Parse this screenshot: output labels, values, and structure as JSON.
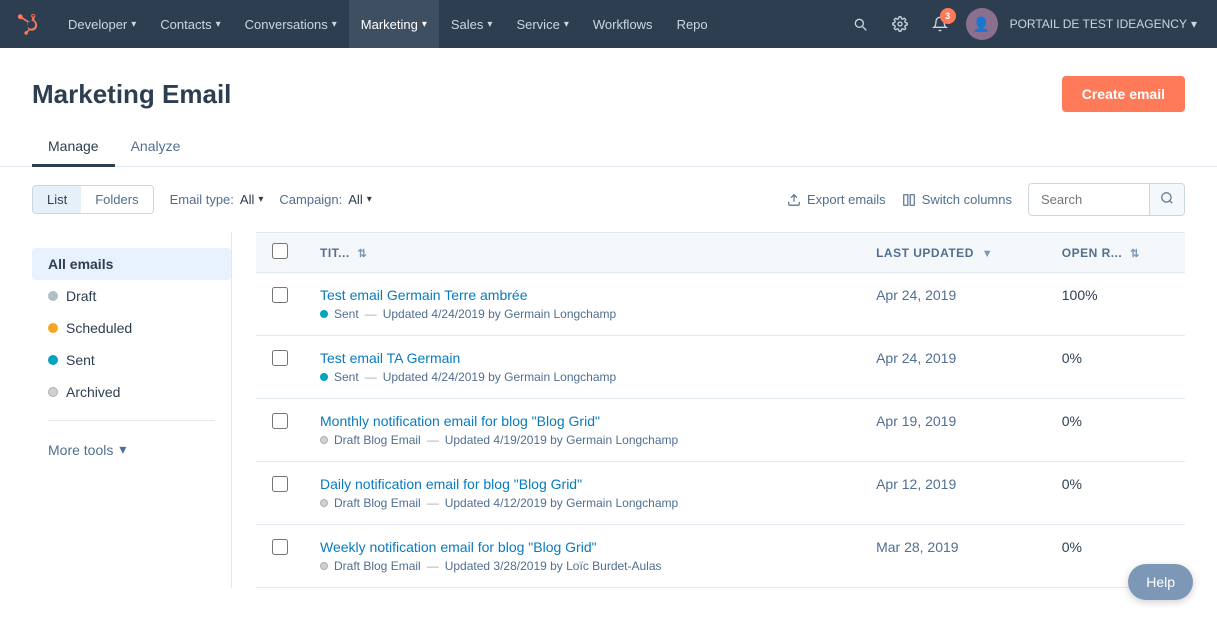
{
  "nav": {
    "logo_unicode": "⬡",
    "items": [
      {
        "label": "Developer",
        "has_chevron": true
      },
      {
        "label": "Contacts",
        "has_chevron": true
      },
      {
        "label": "Conversations",
        "has_chevron": true
      },
      {
        "label": "Marketing",
        "has_chevron": true,
        "active": true
      },
      {
        "label": "Sales",
        "has_chevron": true
      },
      {
        "label": "Service",
        "has_chevron": true
      },
      {
        "label": "Workflows",
        "has_chevron": false
      },
      {
        "label": "Repo",
        "has_chevron": false
      }
    ],
    "notification_count": "3",
    "portal_name": "PORTAIL DE TEST IDEAGENCY"
  },
  "page": {
    "title": "Marketing Email",
    "create_button": "Create email"
  },
  "tabs": [
    {
      "label": "Manage",
      "active": true
    },
    {
      "label": "Analyze",
      "active": false
    }
  ],
  "filters": {
    "list_label": "List",
    "folders_label": "Folders",
    "email_type_label": "Email type:",
    "email_type_value": "All",
    "campaign_label": "Campaign:",
    "campaign_value": "All",
    "export_label": "Export emails",
    "switch_columns_label": "Switch columns",
    "search_placeholder": "Search"
  },
  "sidebar": {
    "all_emails_label": "All emails",
    "items": [
      {
        "label": "Draft",
        "dot_class": "dot-grey"
      },
      {
        "label": "Scheduled",
        "dot_class": "dot-yellow"
      },
      {
        "label": "Sent",
        "dot_class": "dot-green"
      },
      {
        "label": "Archived",
        "dot_class": "dot-light-grey"
      }
    ],
    "more_tools_label": "More tools"
  },
  "table": {
    "headers": [
      {
        "label": "TIT...",
        "sortable": true
      },
      {
        "label": "LAST UPDATED",
        "sortable": true
      },
      {
        "label": "OPEN R...",
        "sortable": true
      }
    ],
    "rows": [
      {
        "name": "Test email Germain Terre ambrée",
        "status": "Sent",
        "status_class": "status-sent",
        "meta": "Updated 4/24/2019 by Germain Longchamp",
        "date": "Apr 24, 2019",
        "rate": "100%"
      },
      {
        "name": "Test email TA Germain",
        "status": "Sent",
        "status_class": "status-sent",
        "meta": "Updated 4/24/2019 by Germain Longchamp",
        "date": "Apr 24, 2019",
        "rate": "0%"
      },
      {
        "name": "Monthly notification email for blog \"Blog Grid\"",
        "status": "Draft Blog Email",
        "status_class": "status-draft",
        "meta": "Updated 4/19/2019 by Germain Longchamp",
        "date": "Apr 19, 2019",
        "rate": "0%"
      },
      {
        "name": "Daily notification email for blog \"Blog Grid\"",
        "status": "Draft Blog Email",
        "status_class": "status-draft",
        "meta": "Updated 4/12/2019 by Germain Longchamp",
        "date": "Apr 12, 2019",
        "rate": "0%"
      },
      {
        "name": "Weekly notification email for blog \"Blog Grid\"",
        "status": "Draft Blog Email",
        "status_class": "status-draft",
        "meta": "Updated 3/28/2019 by Loïc Burdet-Aulas",
        "date": "Mar 28, 2019",
        "rate": "0%"
      }
    ]
  },
  "help_button": "Help"
}
